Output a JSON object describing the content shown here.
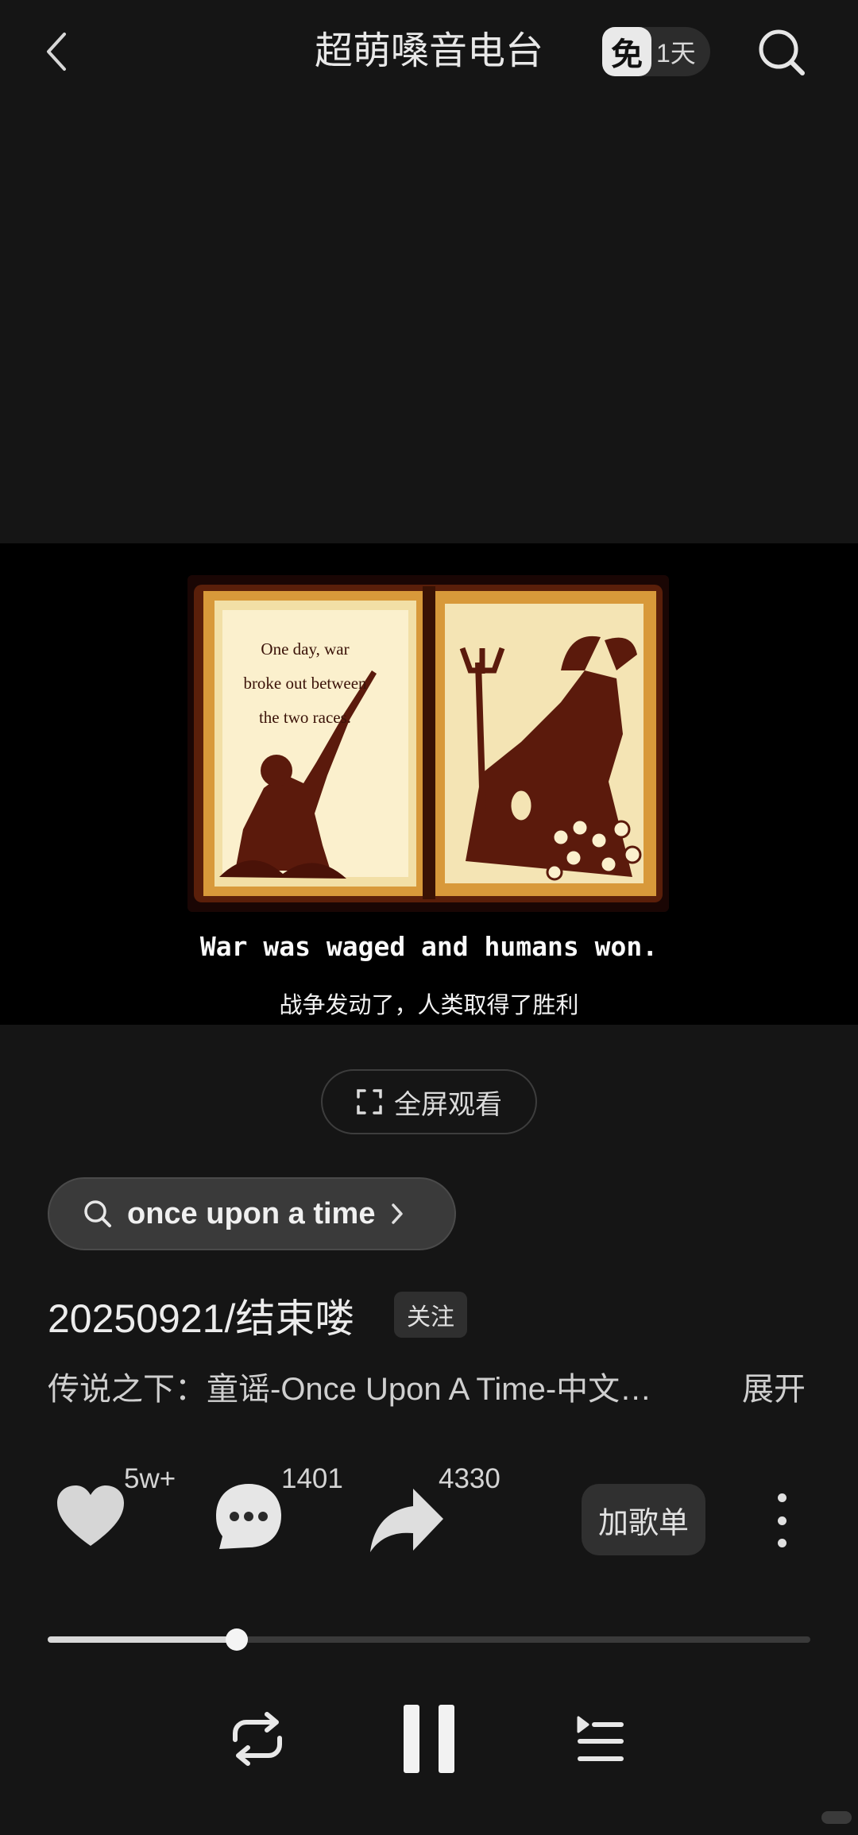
{
  "header": {
    "title": "超萌嗓音电台",
    "vip_badge": "免",
    "vip_days": "1天",
    "back_icon": "chevron-left-icon",
    "search_icon": "search-icon"
  },
  "video": {
    "caption_en": "War was waged and humans won.",
    "caption_zh": "战争发动了，人类取得了胜利",
    "book_text": [
      "One day, war",
      "broke out between",
      "the two races."
    ]
  },
  "fullscreen": {
    "label": "全屏观看",
    "icon": "expand-icon"
  },
  "search_tag": {
    "text": "once upon a time",
    "icon": "search-icon"
  },
  "song": {
    "title": "20250921/结束喽",
    "follow_label": "关注",
    "description": "传说之下：童谣-Once Upon A Time-中文…",
    "expand_label": "展开"
  },
  "actions": {
    "like_count": "5w+",
    "comment_count": "1401",
    "share_count": "4330",
    "add_playlist_label": "加歌单"
  },
  "player": {
    "progress": 0.248
  },
  "colors": {
    "background": "#151515",
    "video_background": "#000000",
    "pill": "#3a3a3a"
  }
}
